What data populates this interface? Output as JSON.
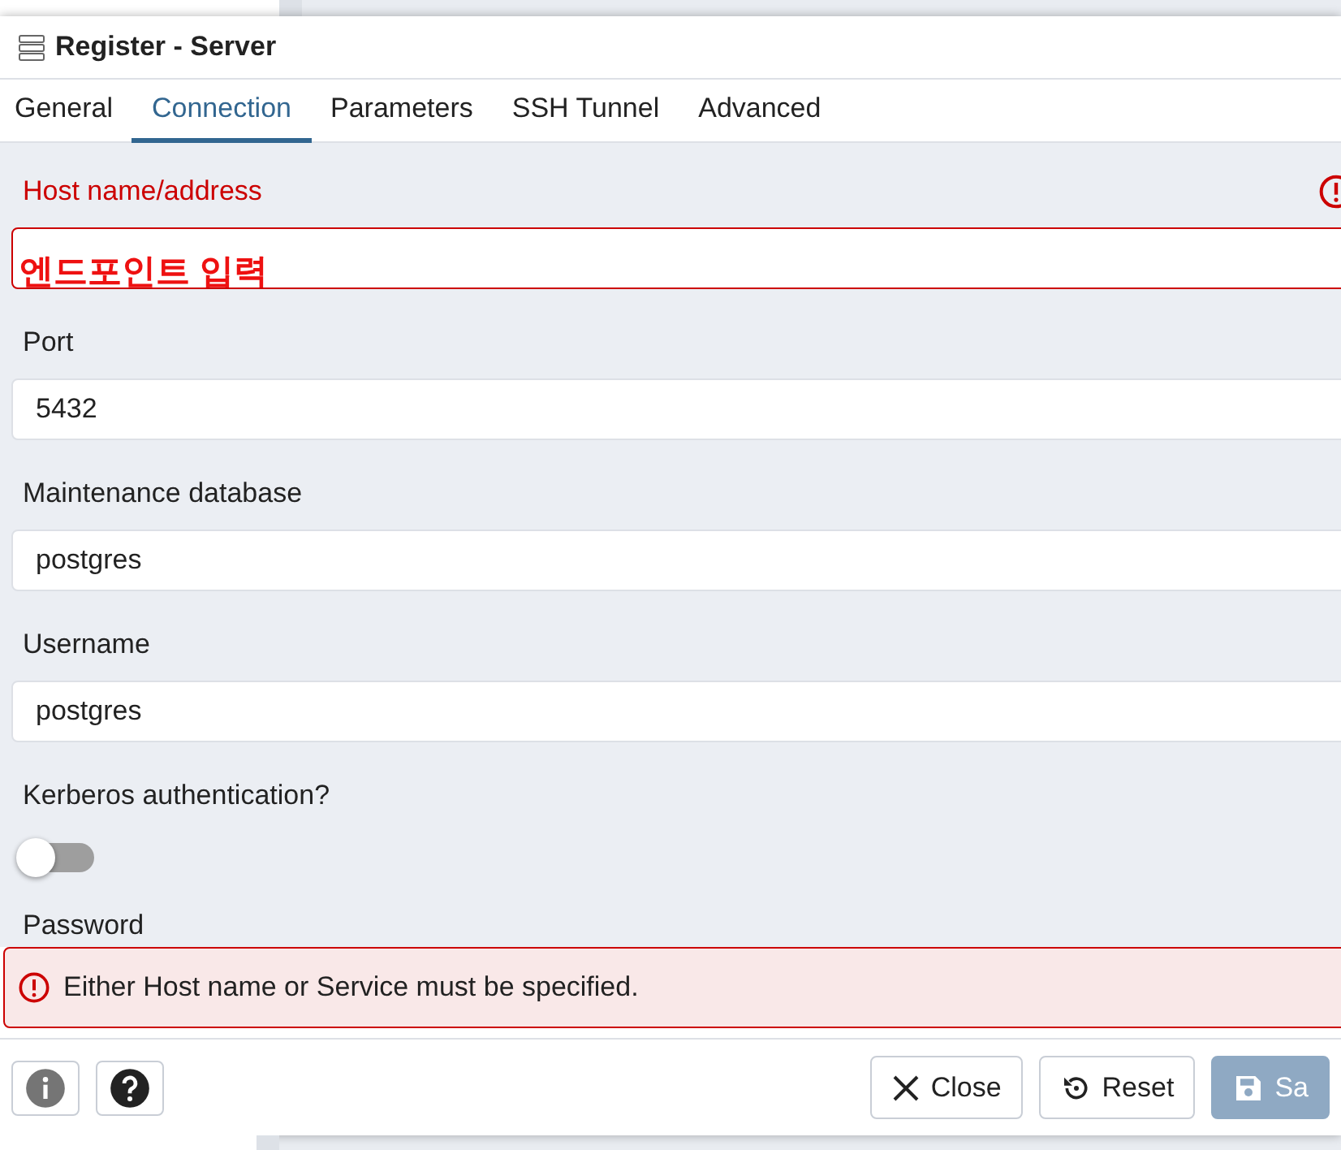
{
  "window": {
    "title": "Register - Server"
  },
  "tabs": [
    {
      "label": "General",
      "selected": false
    },
    {
      "label": "Connection",
      "selected": true
    },
    {
      "label": "Parameters",
      "selected": false
    },
    {
      "label": "SSH Tunnel",
      "selected": false
    },
    {
      "label": "Advanced",
      "selected": false
    }
  ],
  "fields": [
    {
      "kind": "text",
      "label": "Host name/address",
      "value": "엔드포인트 입력",
      "error": true
    },
    {
      "kind": "text",
      "label": "Port",
      "value": "5432",
      "error": false
    },
    {
      "kind": "text",
      "label": "Maintenance database",
      "value": "postgres",
      "error": false
    },
    {
      "kind": "text",
      "label": "Username",
      "value": "postgres",
      "error": false
    },
    {
      "kind": "switch",
      "label": "Kerberos authentication?",
      "on": false
    },
    {
      "kind": "label",
      "label": "Password"
    }
  ],
  "error_message": "Either Host name or Service must be specified.",
  "footer": {
    "buttons": [
      {
        "kind": "close",
        "label": "Close",
        "disabled": false
      },
      {
        "kind": "reset",
        "label": "Reset",
        "disabled": false
      },
      {
        "kind": "save",
        "label": "Sa",
        "disabled": true
      }
    ]
  }
}
